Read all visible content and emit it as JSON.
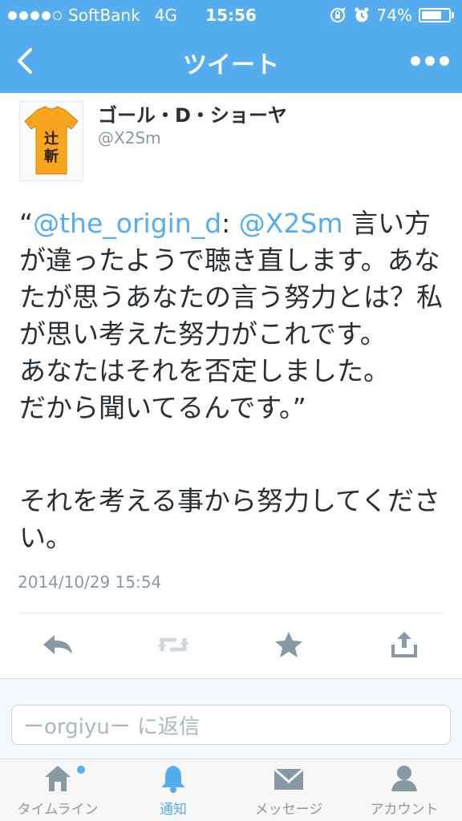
{
  "status_bar": {
    "carrier": "SoftBank",
    "network": "4G",
    "time": "15:56",
    "battery_percent": "74%",
    "battery_level": 0.74,
    "signal_bars": 4,
    "signal_total": 5
  },
  "nav": {
    "title": "ツイート",
    "back_icon": "chevron-left-icon",
    "more_icon": "more-dots-icon"
  },
  "tweet": {
    "user_name": "ゴール・D・ショーヤ",
    "user_handle": "@X2Sm",
    "quote_open": "“",
    "mention_1": "@the_origin_d",
    "colon": ": ",
    "mention_2": "@X2Sm",
    "quoted_text": " 言い方が違ったようで聴き直します。あなたが思うあなたの言う努力とは？私が思い考えた努力がこれです。\nあなたはそれを否定しました。\nだから聞いてるんです。",
    "quote_close": "”",
    "reply_text": "それを考える事から努力してください。",
    "timestamp": "2014/10/29 15:54"
  },
  "actions": {
    "reply_icon": "reply-icon",
    "retweet_icon": "retweet-icon",
    "favorite_icon": "star-icon",
    "share_icon": "share-icon"
  },
  "reply_box": {
    "placeholder": "ーorgiyuー に返信"
  },
  "tabs": [
    {
      "label": "タイムライン",
      "icon": "home-icon",
      "active": false,
      "has_dot": true
    },
    {
      "label": "通知",
      "icon": "bell-icon",
      "active": true,
      "has_dot": false
    },
    {
      "label": "メッセージ",
      "icon": "envelope-icon",
      "active": false,
      "has_dot": false
    },
    {
      "label": "アカウント",
      "icon": "person-icon",
      "active": false,
      "has_dot": false
    }
  ],
  "colors": {
    "brand_blue": "#55acee",
    "text": "#292f33",
    "muted": "#8899a6",
    "avatar_shirt": "#f7a51c"
  }
}
